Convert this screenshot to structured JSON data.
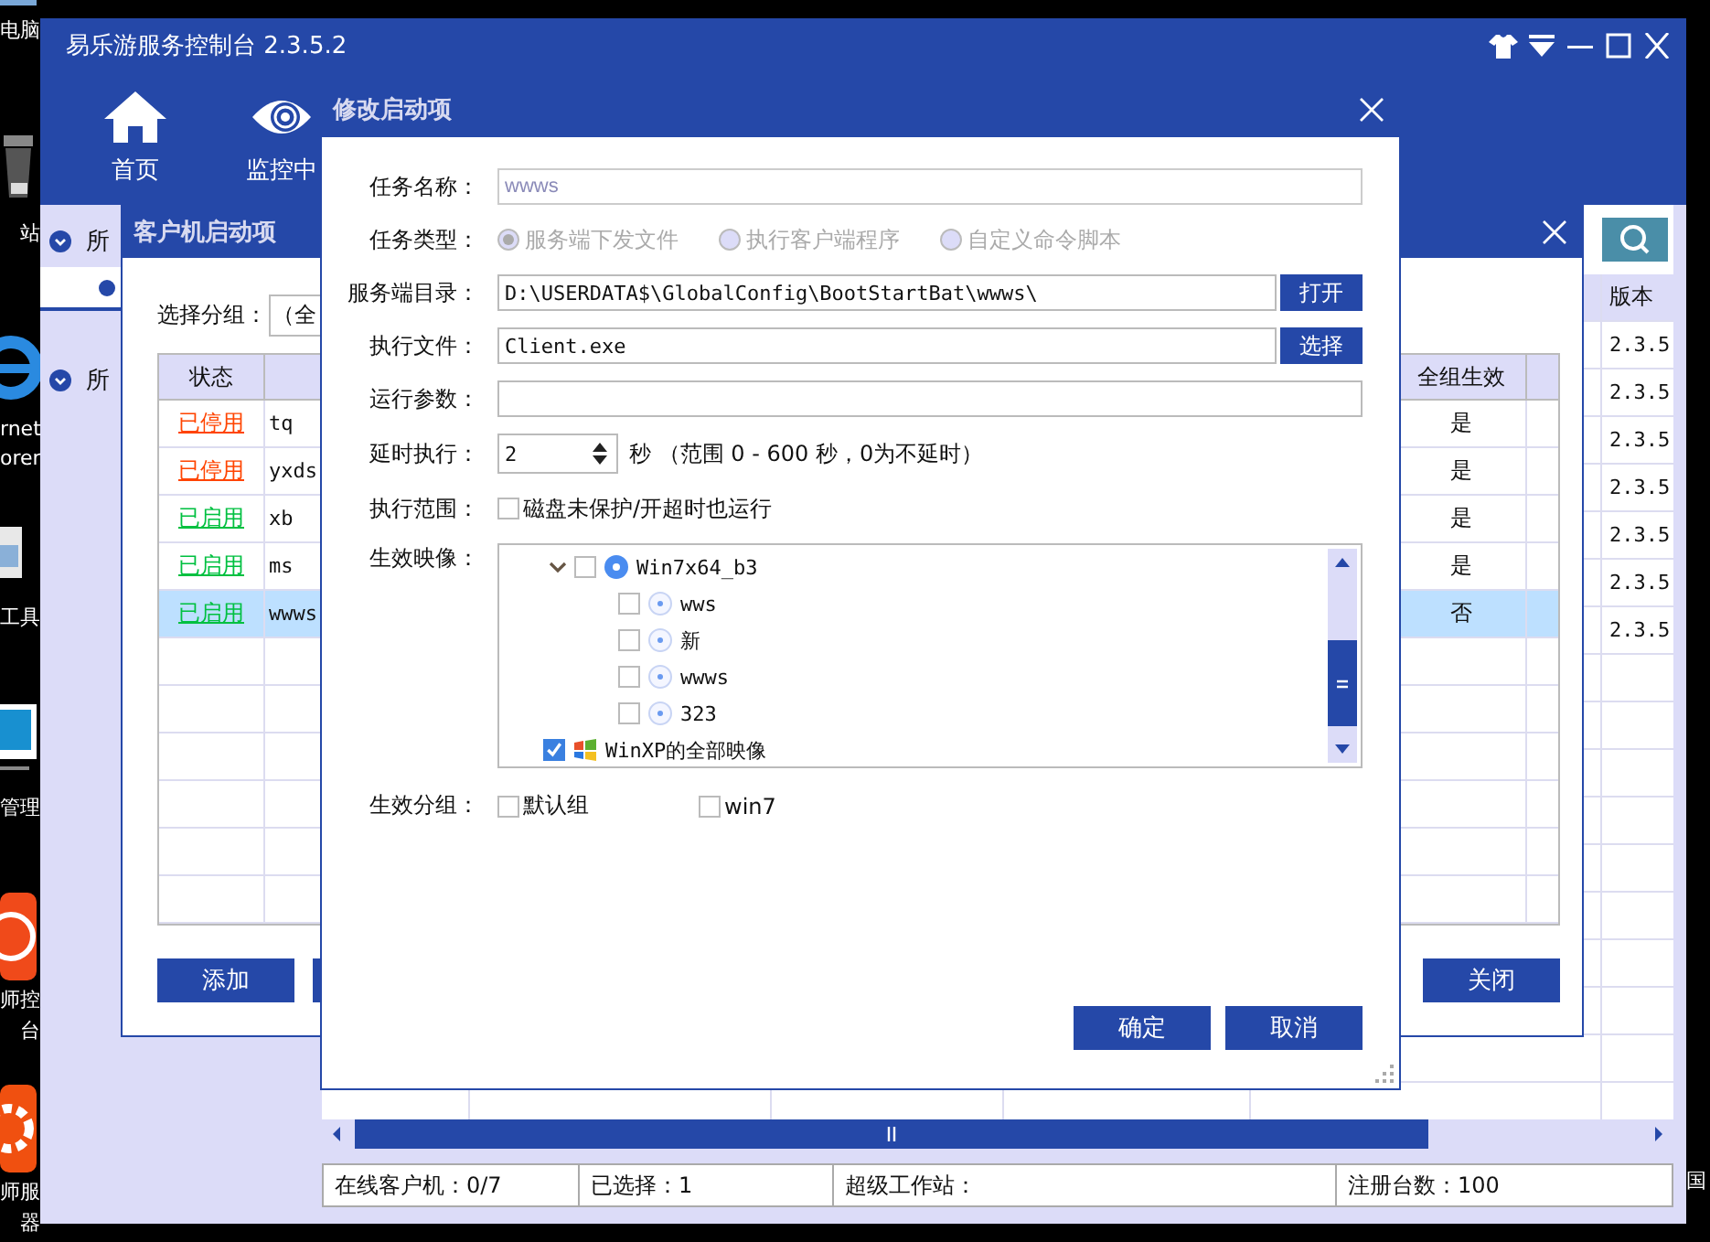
{
  "desktop": {
    "labels": [
      "电脑",
      "站",
      "rnet",
      "orer",
      "工具",
      "管理",
      "师控",
      "台",
      "师服",
      "器"
    ],
    "edge_label": "国"
  },
  "window": {
    "title": "易乐游服务控制台 2.3.5.2"
  },
  "toolbar": [
    {
      "label": "首页",
      "kind": "home"
    },
    {
      "label": "监控中",
      "kind": "eye"
    }
  ],
  "sidebar": {
    "groups": [
      {
        "label": "所",
        "children": [
          {
            "selected": true
          }
        ]
      },
      {
        "label": "所"
      }
    ]
  },
  "client_table": {
    "version_header": "版本",
    "rows": [
      "2.3.5",
      "2.3.5",
      "2.3.5",
      "2.3.5",
      "2.3.5",
      "2.3.5",
      "2.3.5"
    ]
  },
  "status_bar": [
    "在线客户机：0/7",
    "已选择：1",
    "超级工作站：",
    "注册台数：100"
  ],
  "startup_dialog": {
    "title": "客户机启动项",
    "group_label": "选择分组：",
    "group_value": "（全",
    "status_header": "状态",
    "all_groups_header": "全组生效",
    "rows": [
      {
        "status": "已停用",
        "enabled": false,
        "name": "tq",
        "all_groups": "是",
        "selected": false
      },
      {
        "status": "已停用",
        "enabled": false,
        "name": "yxds",
        "all_groups": "是",
        "selected": false
      },
      {
        "status": "已启用",
        "enabled": true,
        "name": "xb",
        "all_groups": "是",
        "selected": false
      },
      {
        "status": "已启用",
        "enabled": true,
        "name": "ms",
        "all_groups": "是",
        "selected": false
      },
      {
        "status": "已启用",
        "enabled": true,
        "name": "wwws",
        "all_groups": "否",
        "selected": true
      }
    ],
    "add_button": "添加",
    "close_button": "关闭"
  },
  "edit_dialog": {
    "title": "修改启动项",
    "task_name": {
      "label": "任务名称：",
      "value": "wwws",
      "disabled": true
    },
    "task_type": {
      "label": "任务类型：",
      "disabled": true,
      "options": [
        {
          "label": "服务端下发文件",
          "selected": true
        },
        {
          "label": "执行客户端程序",
          "selected": false
        },
        {
          "label": "自定义命令脚本",
          "selected": false
        }
      ]
    },
    "server_dir": {
      "label": "服务端目录：",
      "value": "D:\\USERDATA$\\GlobalConfig\\BootStartBat\\wwws\\",
      "button": "打开"
    },
    "exec_file": {
      "label": "执行文件：",
      "value": "Client.exe",
      "button": "选择"
    },
    "run_params": {
      "label": "运行参数："
    },
    "delay": {
      "label": "延时执行：",
      "value": "2",
      "hint": "秒 （范围 0 - 600 秒，0为不延时）"
    },
    "scope": {
      "label": "执行范围：",
      "option": "磁盘未保护/开超时也运行",
      "checked": false
    },
    "images": {
      "label": "生效映像：",
      "tree": [
        {
          "label": "Win7x64_b3",
          "kind": "disk",
          "checked": false,
          "expanded": true,
          "children": [
            {
              "label": "wws",
              "kind": "disk",
              "checked": false
            },
            {
              "label": "新",
              "kind": "disk",
              "checked": false
            },
            {
              "label": "wwws",
              "kind": "disk",
              "checked": false
            },
            {
              "label": "323",
              "kind": "disk",
              "checked": false
            }
          ]
        },
        {
          "label": "WinXP的全部映像",
          "kind": "windows",
          "checked": true
        }
      ]
    },
    "groups": {
      "label": "生效分组：",
      "options": [
        {
          "label": "默认组",
          "checked": false
        },
        {
          "label": "win7",
          "checked": false
        }
      ]
    },
    "ok_button": "确定",
    "cancel_button": "取消"
  }
}
